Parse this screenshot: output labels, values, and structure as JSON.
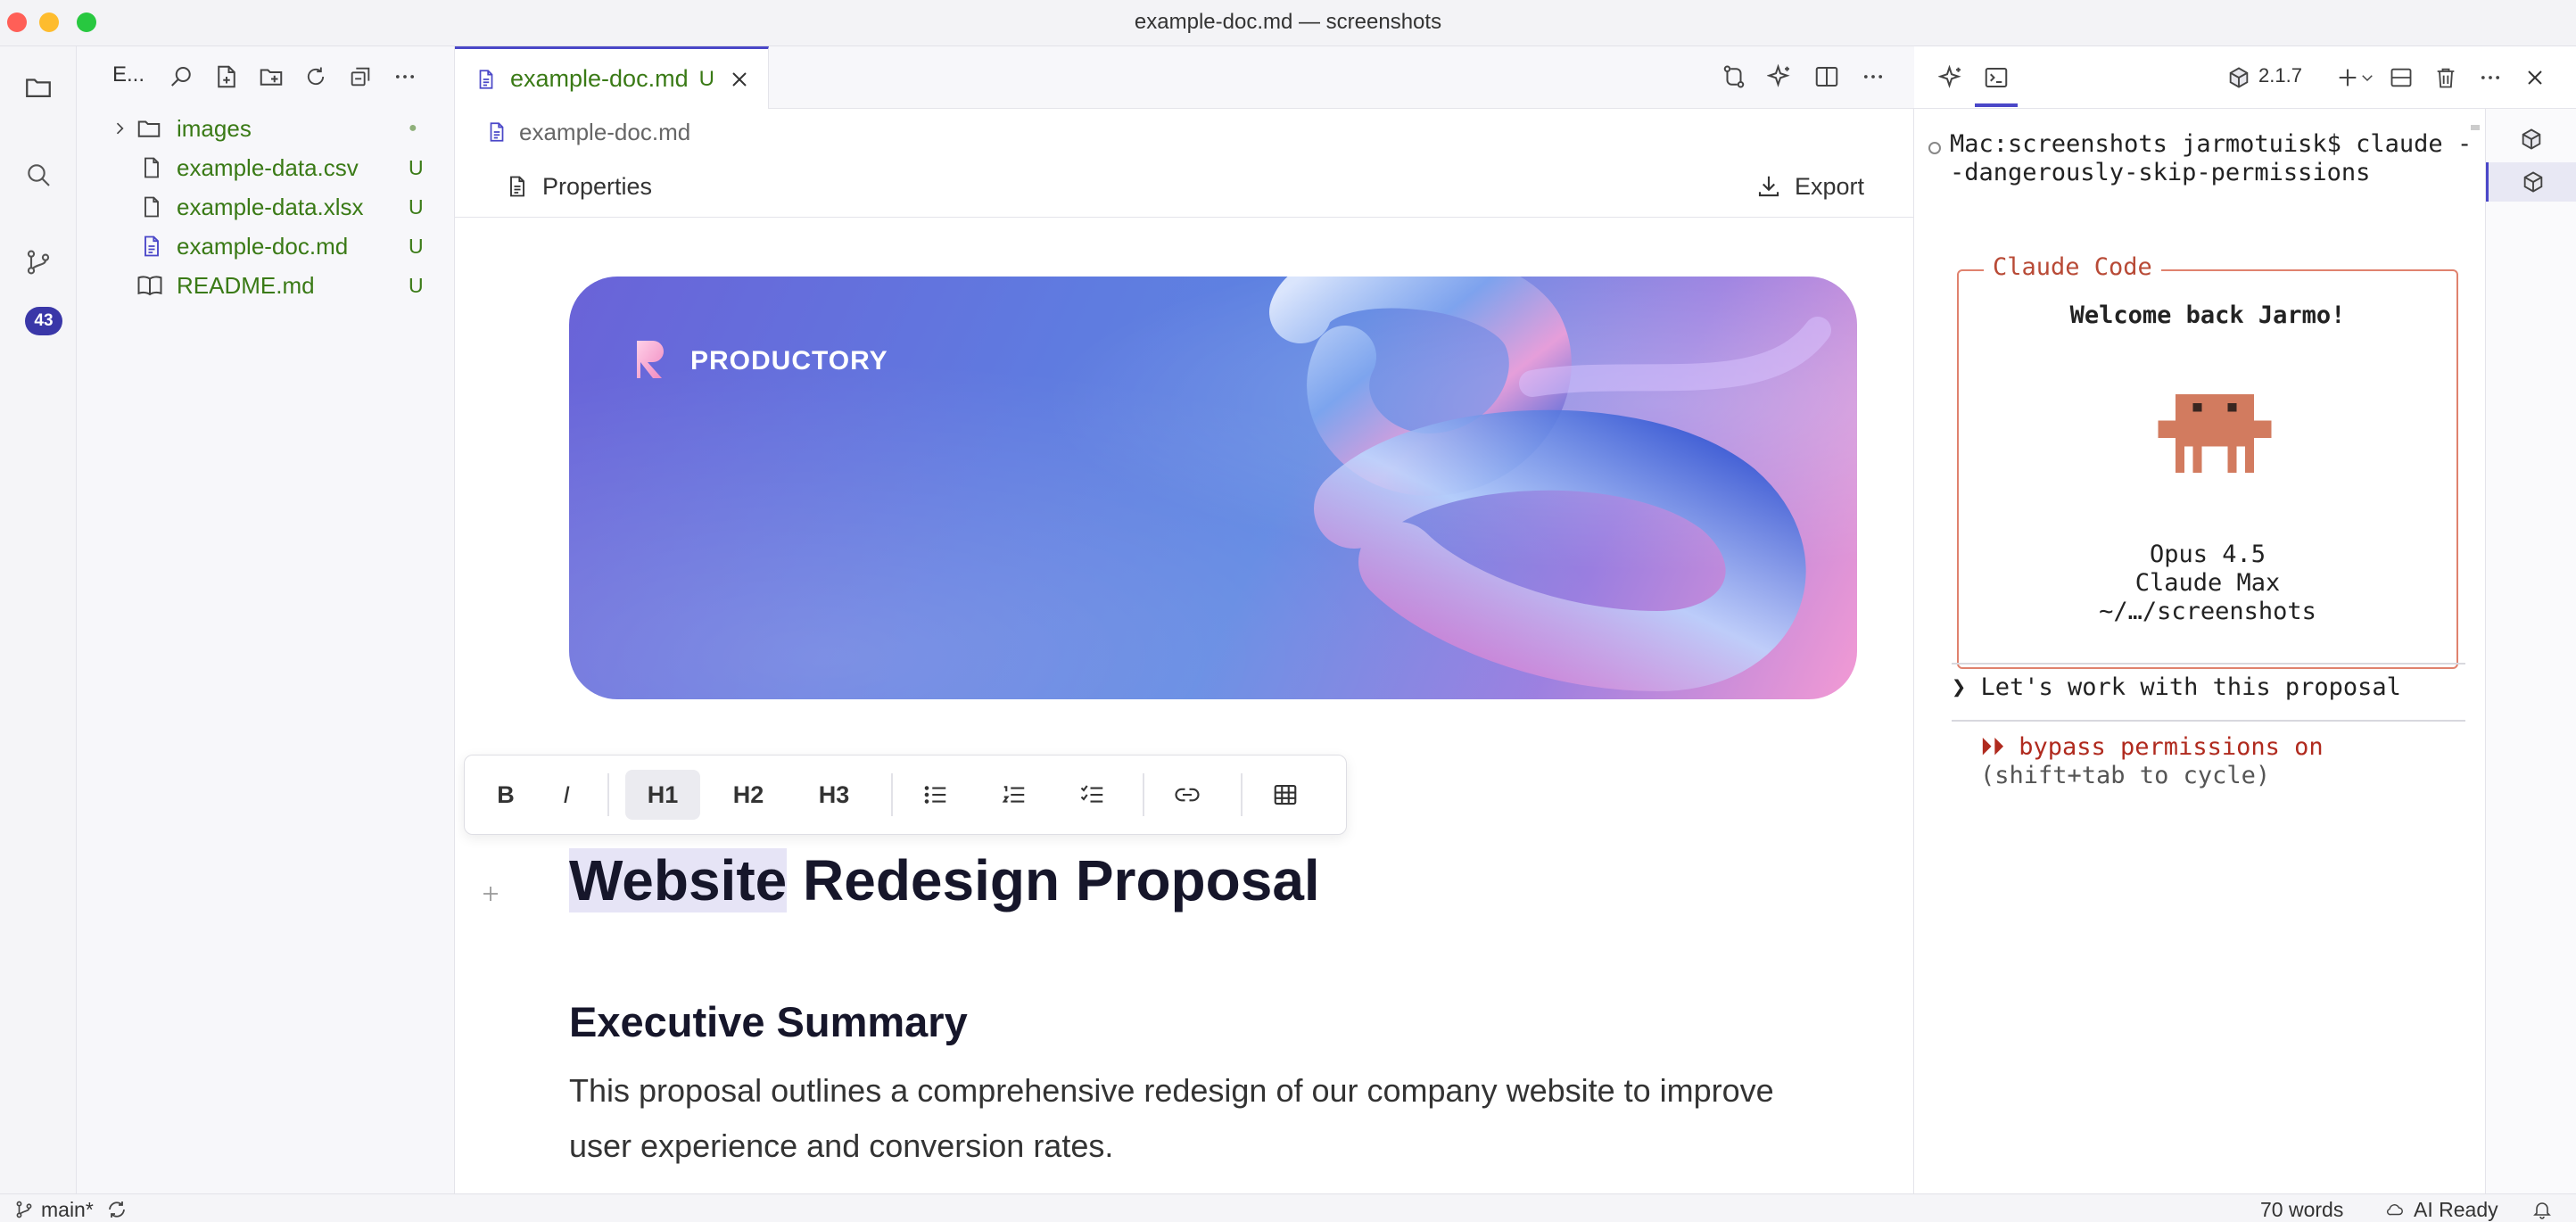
{
  "window": {
    "title": "example-doc.md — screenshots",
    "traffic_colors": [
      "#ff5f57",
      "#febc2e",
      "#28c840"
    ]
  },
  "activity_bar": {
    "items": [
      {
        "name": "explorer",
        "icon": "files-icon"
      },
      {
        "name": "search",
        "icon": "search-icon"
      },
      {
        "name": "source-control",
        "icon": "source-control-icon",
        "badge": "43"
      }
    ]
  },
  "explorer": {
    "title": "E...",
    "actions": [
      "search-icon",
      "new-file-icon",
      "new-folder-icon",
      "refresh-icon",
      "collapse-all-icon",
      "more-icon"
    ],
    "items": [
      {
        "name": "images",
        "type": "folder",
        "status": "●"
      },
      {
        "name": "example-data.csv",
        "type": "file",
        "status": "U"
      },
      {
        "name": "example-data.xlsx",
        "type": "file",
        "status": "U"
      },
      {
        "name": "example-doc.md",
        "type": "markdown",
        "status": "U"
      },
      {
        "name": "README.md",
        "type": "book",
        "status": "U"
      }
    ]
  },
  "editor": {
    "tab": {
      "label": "example-doc.md",
      "status": "U"
    },
    "breadcrumb": "example-doc.md",
    "properties_label": "Properties",
    "export_label": "Export",
    "banner": {
      "brand": "PRODUCTORY"
    },
    "toolbar": {
      "bold": "B",
      "italic": "I",
      "h1": "H1",
      "h2": "H2",
      "h3": "H3"
    },
    "doc": {
      "title_highlight": "Website",
      "title_rest": " Redesign Proposal",
      "h2": "Executive Summary",
      "paragraph": "This proposal outlines a comprehensive redesign of our company website to improve user experience and conversion rates."
    }
  },
  "panel": {
    "version": "2.1.7",
    "terminal": {
      "prompt": "Mac:screenshots jarmotuisk$ claude --dangerously-skip-permissions",
      "box_title": "Claude Code",
      "welcome": "Welcome back Jarmo!",
      "model": "Opus 4.5",
      "plan": "Claude Max",
      "cwd": "~/…/screenshots",
      "input": "❯ Let's work with this proposal",
      "bypass": "⏵⏵ bypass permissions on",
      "cycle_hint": "(shift+tab to cycle)"
    }
  },
  "statusbar": {
    "branch": "main*",
    "word_count": "70 words",
    "ai_status": "AI Ready"
  },
  "colors": {
    "accent": "#4a47c8",
    "git_untracked": "#3a7a16",
    "claude_orange": "#e0826e",
    "mascot": "#d27b5f"
  }
}
